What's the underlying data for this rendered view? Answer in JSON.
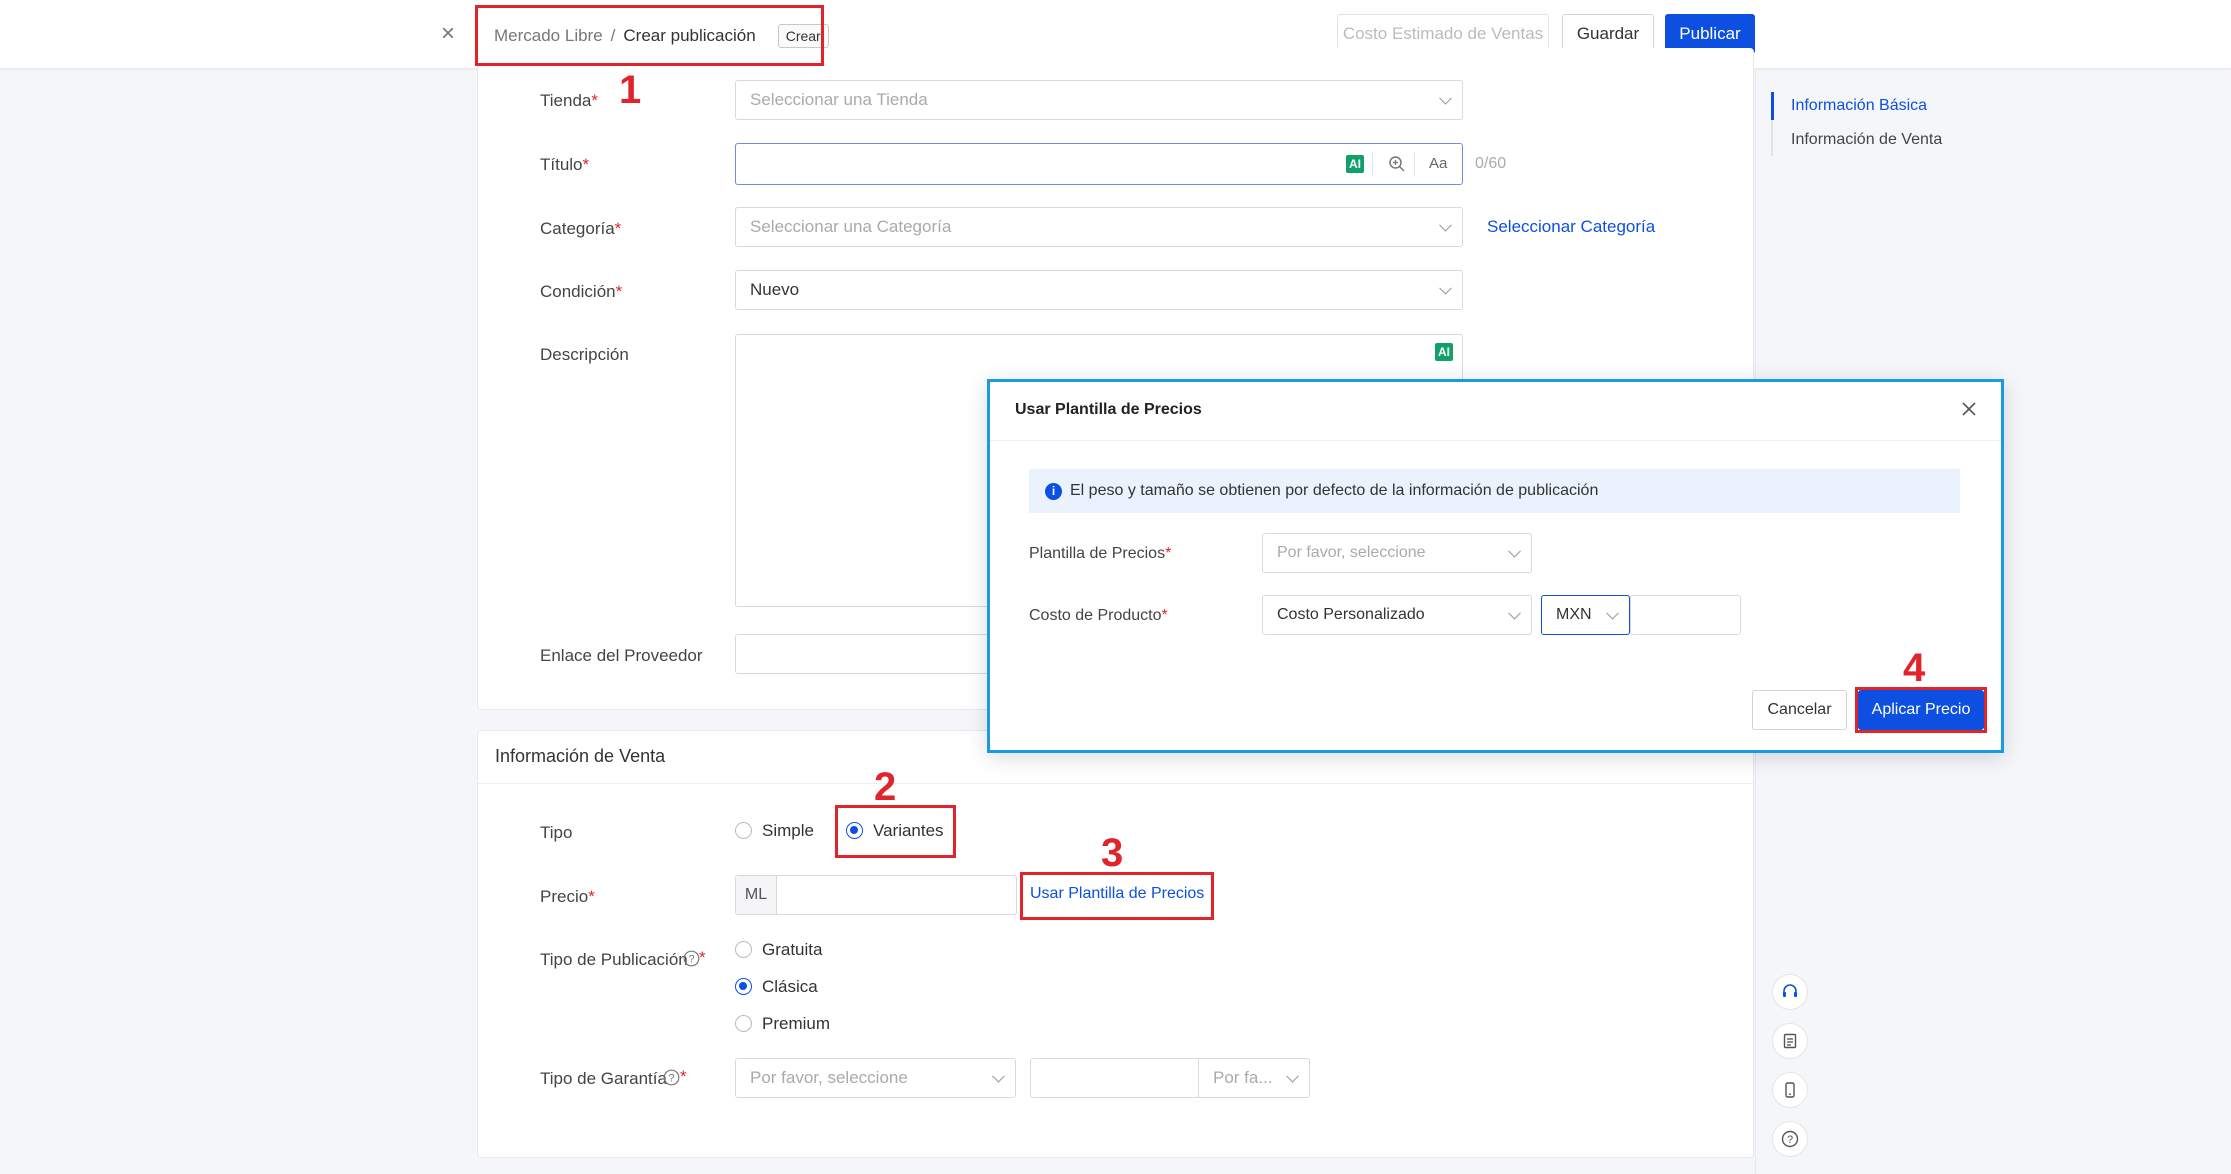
{
  "header": {
    "close": "×",
    "breadcrumb_root": "Mercado Libre",
    "breadcrumb_sep": "/",
    "breadcrumb_current": "Crear publicación",
    "tag": "Crear",
    "btn_cost": "Costo Estimado de Ventas",
    "btn_save": "Guardar",
    "btn_publish": "Publicar"
  },
  "basic": {
    "tienda_label": "Tienda",
    "tienda_placeholder": "Seleccionar una Tienda",
    "titulo_label": "Título",
    "titulo_ai": "AI",
    "titulo_case": "Aa",
    "titulo_count": "0/60",
    "categoria_label": "Categoría",
    "categoria_placeholder": "Seleccionar una Categoría",
    "categoria_link": "Seleccionar Categoría",
    "condicion_label": "Condición",
    "condicion_value": "Nuevo",
    "descripcion_label": "Descripción",
    "descripcion_ai": "AI",
    "enlace_label": "Enlace del Proveedor",
    "required_mark": "*"
  },
  "venta": {
    "section_title": "Información de Venta",
    "tipo_label": "Tipo",
    "tipo_options": [
      "Simple",
      "Variantes"
    ],
    "tipo_selected": "Variantes",
    "precio_label": "Precio",
    "precio_prefix": "ML",
    "precio_link": "Usar Plantilla de Precios",
    "tipo_pub_label": "Tipo de Publicación",
    "tipo_pub_options": [
      "Gratuita",
      "Clásica",
      "Premium"
    ],
    "tipo_pub_selected": "Clásica",
    "garantia_label": "Tipo de Garantía",
    "garantia_placeholder": "Por favor, seleccione",
    "garantia_unit_placeholder": "Por fa..."
  },
  "sidenav": {
    "items": [
      "Información Básica",
      "Información de Venta"
    ],
    "active": "Información Básica"
  },
  "modal": {
    "title": "Usar Plantilla de Precios",
    "info": "El peso y tamaño se obtienen por defecto de la información de publicación",
    "plantilla_label": "Plantilla de Precios",
    "plantilla_placeholder": "Por favor, seleccione",
    "costo_label": "Costo de Producto",
    "costo_value": "Costo Personalizado",
    "currency": "MXN",
    "btn_cancel": "Cancelar",
    "btn_apply": "Aplicar Precio"
  },
  "annotations": [
    "1",
    "2",
    "3",
    "4"
  ],
  "colors": {
    "primary": "#0d4fe0",
    "annotation": "#e0242b",
    "modal_border": "#1a9ae0",
    "ai_badge": "#12a06a"
  },
  "icons": [
    "close-icon",
    "chevron-down-icon",
    "ai-icon",
    "search-zoom-icon",
    "info-icon",
    "help-icon",
    "headset-icon",
    "clipboard-icon",
    "mobile-icon",
    "question-icon"
  ]
}
